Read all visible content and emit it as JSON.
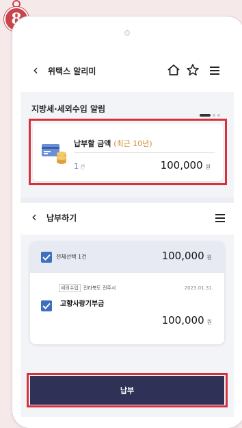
{
  "step": {
    "number": "8"
  },
  "header": {
    "back_icon": "chevron-left-icon",
    "title": "위택스 알리미",
    "icons": [
      "home-icon",
      "star-icon",
      "menu-icon"
    ]
  },
  "alert_section": {
    "title": "지방세·세외수입 알림",
    "card": {
      "icon": "bill-coins-icon",
      "label": "납부할 금액",
      "label_sub": "(최근 10년)",
      "count": "1",
      "count_unit": "건",
      "amount": "100,000",
      "amount_unit": "원"
    }
  },
  "payment_section": {
    "title": "납부하기",
    "select_all": {
      "checked": true,
      "label": "전체선택 1건",
      "amount": "100,000",
      "amount_unit": "원"
    },
    "items": [
      {
        "checked": true,
        "tag": "세외수입",
        "region": "전라북도 전주시",
        "date": "2023.01.31.",
        "name": "고향사랑기부금",
        "amount": "100,000",
        "amount_unit": "원"
      }
    ],
    "pay_button_label": "납부"
  },
  "colors": {
    "highlight_border": "#d6303d",
    "pay_button": "#2f3157",
    "checkbox": "#3d6fbd",
    "badge": "#c8454d"
  }
}
